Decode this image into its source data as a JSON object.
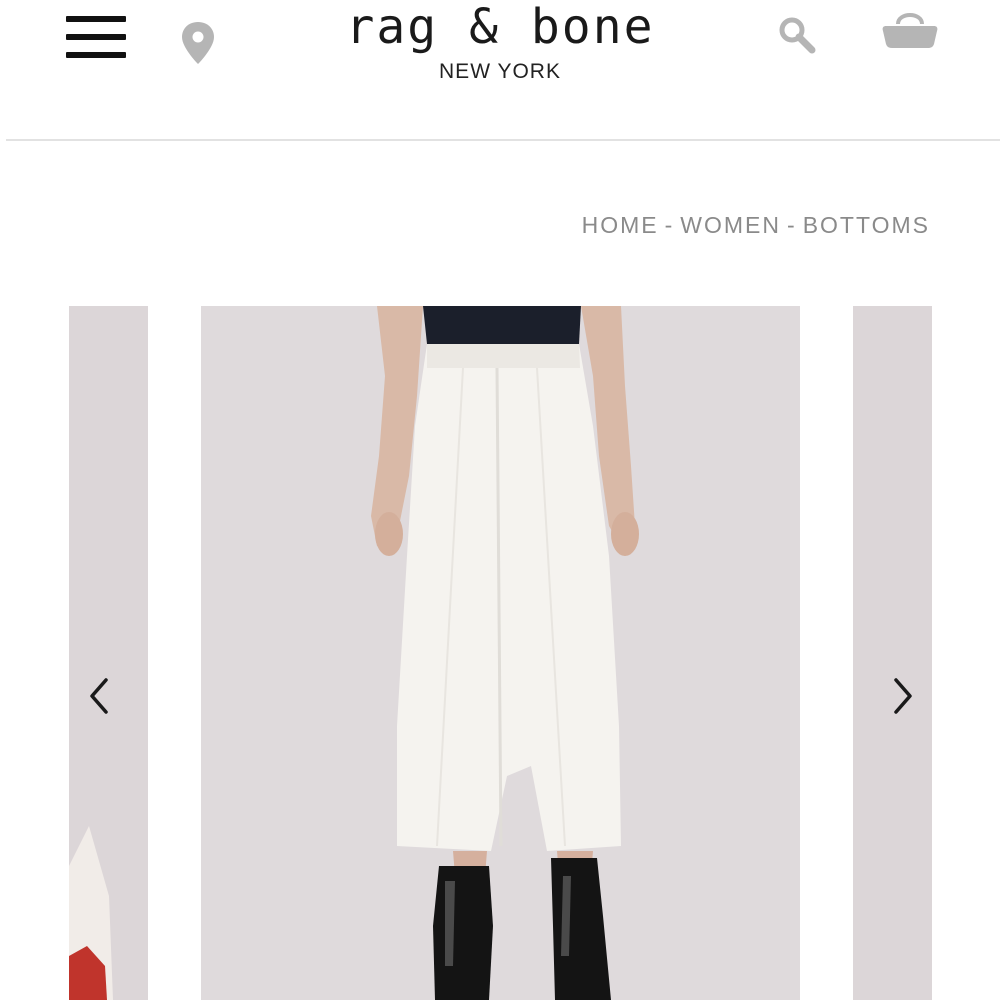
{
  "header": {
    "brand": "rag & bone",
    "brand_location": "NEW YORK",
    "icons": {
      "menu": "hamburger-menu-icon",
      "location": "map-pin-icon",
      "search": "search-icon",
      "bag": "shopping-bag-icon"
    }
  },
  "breadcrumb": {
    "items": [
      "HOME",
      "WOMEN",
      "BOTTOMS"
    ],
    "separator": "-"
  },
  "carousel": {
    "prev_icon": "chevron-left-icon",
    "next_icon": "chevron-right-icon",
    "main_image": "product-photo-white-wide-leg-culottes",
    "prev_image": "product-photo-partial-red-boot",
    "next_image": "product-photo-partial"
  },
  "colors": {
    "icon_gray": "#b5b5b5",
    "text_gray": "#8a8a8a",
    "brand_black": "#1a1a1a",
    "photo_background": "#dfdadc"
  }
}
